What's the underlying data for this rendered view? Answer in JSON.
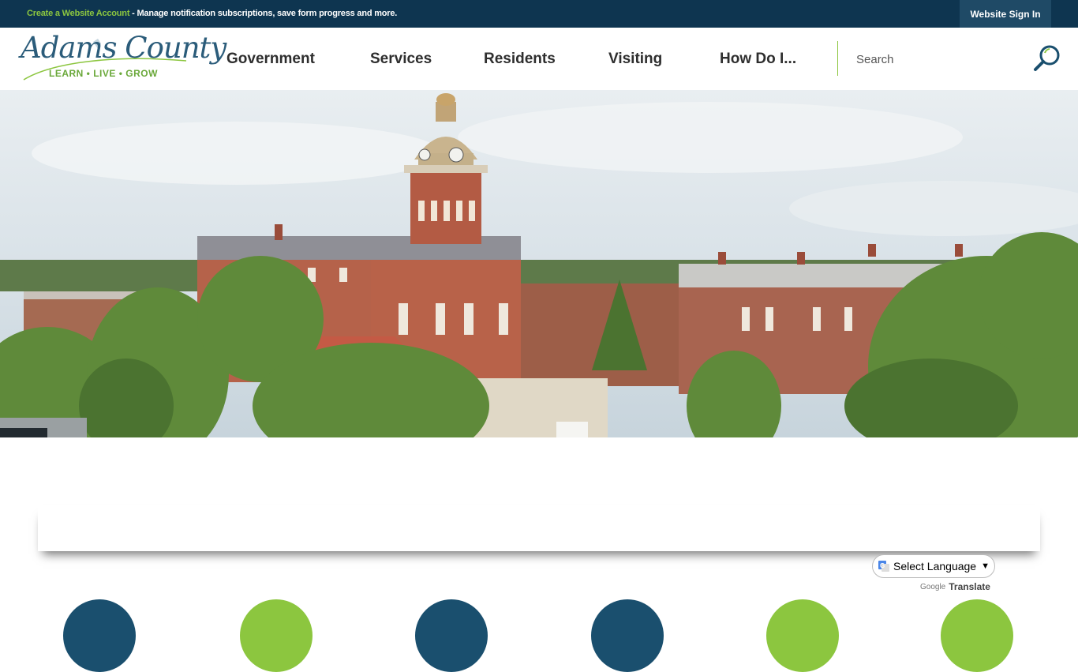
{
  "topbar": {
    "create_link": "Create a Website Account",
    "message": " - Manage notification subscriptions, save form progress and more.",
    "signin_label": "Website Sign In"
  },
  "logo": {
    "title": "Adams County",
    "tagline": "LEARN • LIVE • GROW"
  },
  "nav": {
    "items": [
      "Government",
      "Services",
      "Residents",
      "Visiting",
      "How Do I..."
    ]
  },
  "search": {
    "placeholder": "Search"
  },
  "translate": {
    "select_label": "Select Language",
    "powered_google": "Google",
    "powered_translate": "Translate"
  },
  "colors": {
    "topbar": "#0e3550",
    "accent_green": "#8cc63f",
    "dark_blue": "#1a4f6e"
  },
  "quick_links": [
    {
      "icon": "circle-icon",
      "color": "#1a4f6e"
    },
    {
      "icon": "circle-icon",
      "color": "#8cc63f"
    },
    {
      "icon": "circle-icon",
      "color": "#1a4f6e"
    },
    {
      "icon": "circle-icon",
      "color": "#1a4f6e"
    },
    {
      "icon": "circle-icon",
      "color": "#8cc63f"
    },
    {
      "icon": "circle-icon",
      "color": "#8cc63f"
    }
  ]
}
